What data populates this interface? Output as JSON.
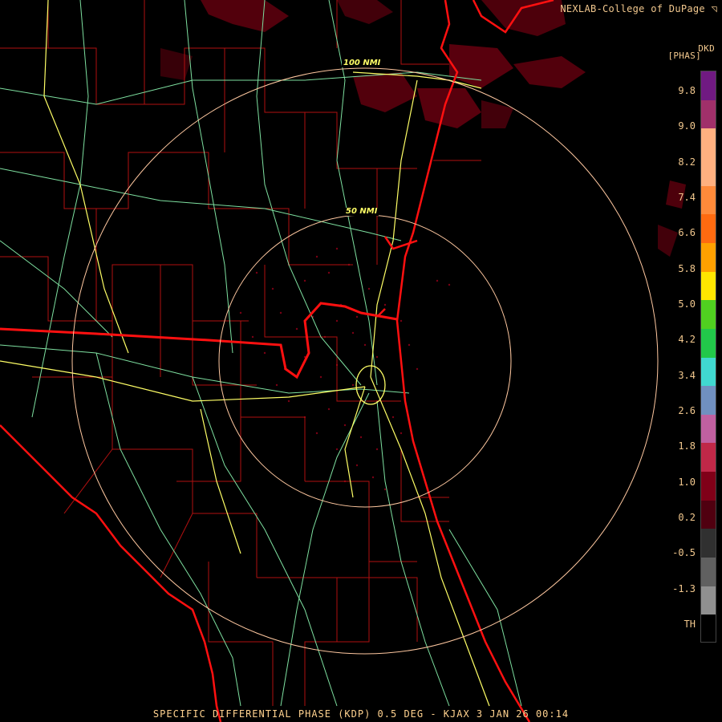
{
  "header": {
    "credit": "NEXLAB-College of DuPage ◹",
    "product": "DKD",
    "units": "[PHAS]"
  },
  "legend": {
    "labels": [
      "9.8",
      "9.0",
      "8.2",
      "7.4",
      "6.6",
      "5.8",
      "5.0",
      "4.2",
      "3.4",
      "2.6",
      "1.8",
      "1.0",
      "0.2",
      "-0.5",
      "-1.3",
      "TH"
    ],
    "colors": [
      "#701a82",
      "#a0306a",
      "#ffb080",
      "#ffb080",
      "#ff8a3a",
      "#ff6a10",
      "#ffa000",
      "#ffe600",
      "#50d020",
      "#22c84a",
      "#40d8d0",
      "#7090c0",
      "#c060a0",
      "#c02848",
      "#800018",
      "#500010",
      "#303030",
      "#606060",
      "#909090",
      "#000000"
    ]
  },
  "map": {
    "range_rings": [
      "100 NMI",
      "50 NMI"
    ],
    "colors": {
      "state_border": "#ff1010",
      "county_border": "#b01010",
      "coastline": "#ff1010",
      "interstate": "#ffff66",
      "highway": "#7ee0a0",
      "range_ring": "#ffc8a0",
      "echo": "#8a0010"
    }
  },
  "footer": {
    "caption": "SPECIFIC DIFFERENTIAL PHASE (KDP) 0.5 DEG - KJAX 3 JAN 26 00:14"
  }
}
